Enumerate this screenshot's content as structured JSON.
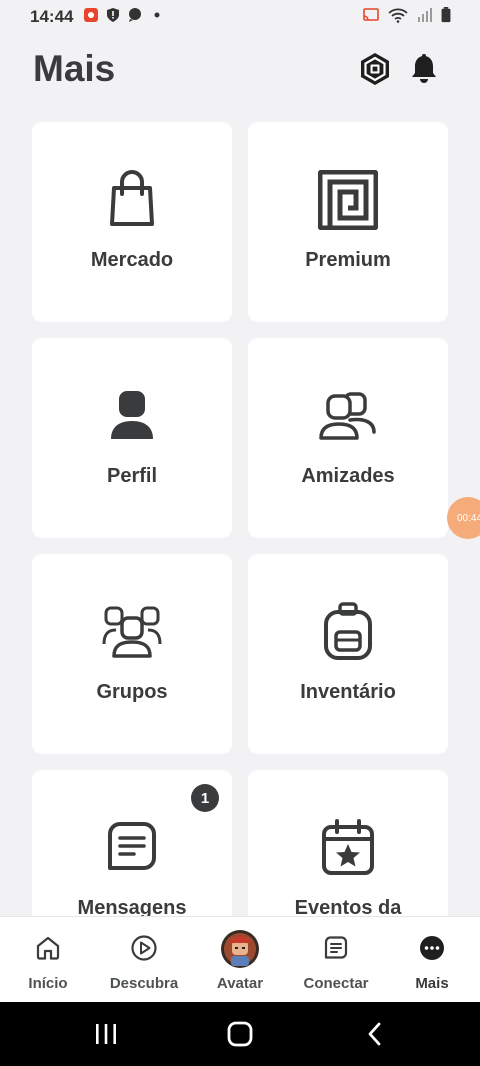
{
  "status_bar": {
    "time": "14:44"
  },
  "header": {
    "title": "Mais"
  },
  "tiles": [
    {
      "label": "Mercado"
    },
    {
      "label": "Premium"
    },
    {
      "label": "Perfil"
    },
    {
      "label": "Amizades"
    },
    {
      "label": "Grupos"
    },
    {
      "label": "Inventário"
    },
    {
      "label": "Mensagens",
      "badge": "1"
    },
    {
      "label": "Eventos da"
    }
  ],
  "floating_recorder": {
    "text": "00:44"
  },
  "tab_bar": {
    "tabs": [
      {
        "label": "Início"
      },
      {
        "label": "Descubra"
      },
      {
        "label": "Avatar"
      },
      {
        "label": "Conectar"
      },
      {
        "label": "Mais",
        "active": true
      }
    ]
  },
  "colors": {
    "background": "#f2f2f4",
    "tile": "#ffffff",
    "text": "#393b3d",
    "recorder": "#f5ab7a"
  }
}
